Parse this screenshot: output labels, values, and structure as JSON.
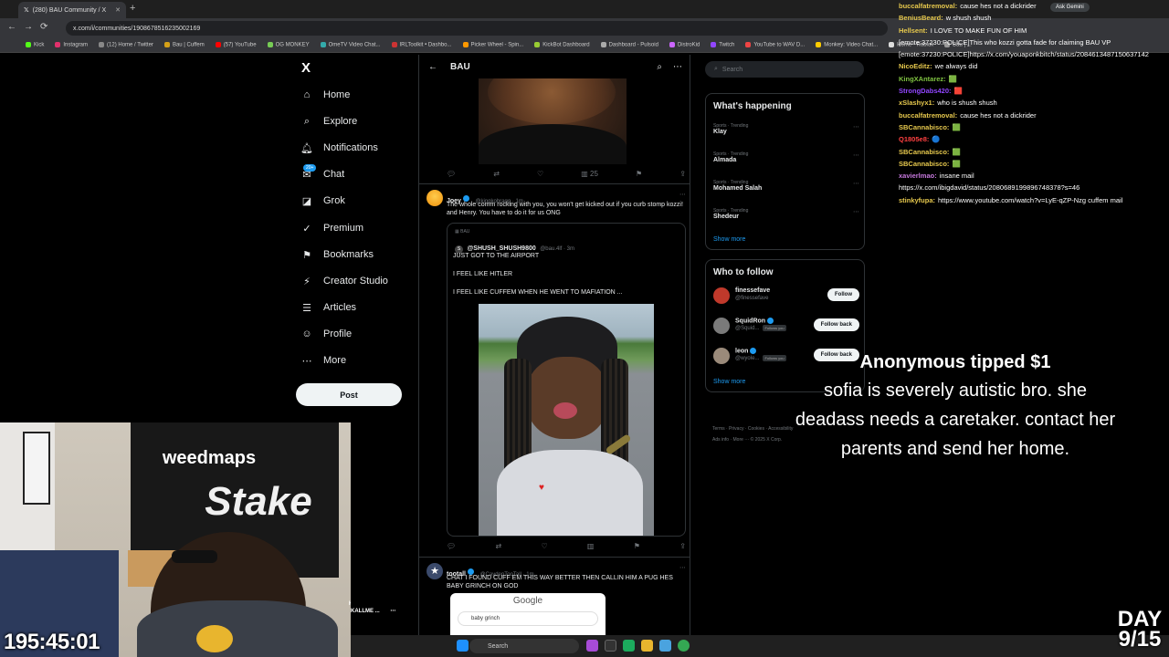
{
  "browser": {
    "tab_title": "(280) BAU Community / X",
    "url": "x.com/i/communities/1908678516235002169",
    "bookmarks": [
      "Kick",
      "Instagram",
      "(12) Home / Twitter",
      "Bau | Cuffem",
      "(57) YouTube",
      "OG MONKEY",
      "OmeTV Video Chat...",
      "IRLToolkit • Dashbo...",
      "Picker Wheel - Spin...",
      "KickBot Dashboard",
      "Dashboard - Pulsoid",
      "DistroKid",
      "Twitch",
      "YouTube to WAV D...",
      "Monkey: Video Chat...",
      "Home - Roblox",
      "Bau | ..."
    ],
    "bookmark_colors": [
      "#53fc18",
      "#e1306c",
      "#888888",
      "#d4a017",
      "#ff0000",
      "#7c5",
      "#3aa",
      "#c33",
      "#f90",
      "#9c3",
      "#aaa",
      "#c6f",
      "#9146ff",
      "#e44",
      "#fc0",
      "#ddd",
      "#999"
    ]
  },
  "nav": {
    "logo": "X",
    "items": [
      {
        "label": "Home",
        "icon": "home-icon",
        "glyph": "⌂"
      },
      {
        "label": "Explore",
        "icon": "search-icon",
        "glyph": "⌕"
      },
      {
        "label": "Notifications",
        "icon": "bell-icon",
        "glyph": "🔔︎"
      },
      {
        "label": "Chat",
        "icon": "chat-icon",
        "glyph": "✉"
      },
      {
        "label": "Grok",
        "icon": "grok-icon",
        "glyph": "◪"
      },
      {
        "label": "Premium",
        "icon": "premium-icon",
        "glyph": "✓"
      },
      {
        "label": "Bookmarks",
        "icon": "bookmark-icon",
        "glyph": "⚑"
      },
      {
        "label": "Creator Studio",
        "icon": "creator-icon",
        "glyph": "⚡"
      },
      {
        "label": "Articles",
        "icon": "articles-icon",
        "glyph": "☰"
      },
      {
        "label": "Profile",
        "icon": "profile-icon",
        "glyph": "☺"
      },
      {
        "label": "More",
        "icon": "more-icon",
        "glyph": "⋯"
      }
    ],
    "chat_badge": "20+",
    "post_label": "Post",
    "account_partial": "KALLME ..."
  },
  "center": {
    "title": "BAU",
    "tweet1_views": "25",
    "tweet2": {
      "name": "Joey",
      "handle": "@kingkobragg · 1m",
      "text": "The whole comm rocking with you, you won't get kicked out if you curb stomp kozzi! and Henry. You have to do it for us ONG",
      "quote_community": "BAU",
      "quote_name": "@SHUSH_SHUSH9800",
      "quote_handle": "@bau.4lf · 3m",
      "quote_lines": [
        "JUST GOT TO THE AIRPORT",
        "I FEEL LIKE HITLER",
        "I FEEL LIKE CUFFEM WHEN HE WENT TO MAFIATION ..."
      ]
    },
    "tweet3": {
      "name": "tootall",
      "handle": "@CaydenTooTall · 1m",
      "text": "CHAT I FOUND CUFF EM THIS WAY BETTER THEN CALLIN HIM A PUG HES BABY GRINCH ON GOD",
      "google_logo": "Google",
      "google_query": "baby grinch"
    }
  },
  "right": {
    "search_placeholder": "Search",
    "happening_title": "What's happening",
    "trends": [
      {
        "category": "Sports · Trending",
        "name": "Klay"
      },
      {
        "category": "Sports · Trending",
        "name": "Almada"
      },
      {
        "category": "Sports · Trending",
        "name": "Mohamed Salah"
      },
      {
        "category": "Sports · Trending",
        "name": "Shedeur"
      }
    ],
    "show_more": "Show more",
    "who_title": "Who to follow",
    "follows": [
      {
        "name": "finessefave",
        "handle": "@finessefave",
        "button": "Follow",
        "follows_you": ""
      },
      {
        "name": "SquidRon",
        "handle": "@Squid...",
        "button": "Follow back",
        "follows_you": "Follows you"
      },
      {
        "name": "leon",
        "handle": "@wyole...",
        "button": "Follow back",
        "follows_you": "Follows you"
      }
    ],
    "footer1": "Terms · Privacy · Cookies · Accessibility",
    "footer2": "Ads info · More ··· © 2025 X Corp."
  },
  "chat": {
    "ask_gemini": "Ask Gemini",
    "lines": [
      {
        "user": "buccalfatremoval:",
        "color": "#e6c84d",
        "msg": "cause hes not a dickrider"
      },
      {
        "user": "BeniusBeard:",
        "color": "#e6c84d",
        "msg": "w shush shush"
      },
      {
        "user": "Hellsent:",
        "color": "#e6c84d",
        "msg": "I LOVE TO MAKE FUN OF HIM"
      },
      {
        "user": "",
        "color": "#ffffff",
        "msg": "[emote:37230:POLICE]This who kozzi gotta fade for claiming BAU VP"
      },
      {
        "user": "",
        "color": "#ffffff",
        "msg": "[emote:37230:POLICE]https://x.com/youaponkbitch/status/2084613487150637142"
      },
      {
        "user": "NicoEditz:",
        "color": "#e6c84d",
        "msg": "we always did"
      },
      {
        "user": "KingXAntarez:",
        "color": "#7fc241",
        "msg": "🟩"
      },
      {
        "user": "StrongDabs420:",
        "color": "#9146ff",
        "msg": "🟥"
      },
      {
        "user": "xSlashyx1:",
        "color": "#e6c84d",
        "msg": "who is shush shush"
      },
      {
        "user": "buccalfatremoval:",
        "color": "#e6c84d",
        "msg": "cause hes not a dickrider"
      },
      {
        "user": "SBCannabisco:",
        "color": "#e6c84d",
        "msg": "🟩"
      },
      {
        "user": "Q1805e8:",
        "color": "#ff4040",
        "msg": "🔵"
      },
      {
        "user": "SBCannabisco:",
        "color": "#e6c84d",
        "msg": "🟩"
      },
      {
        "user": "SBCannabisco:",
        "color": "#e6c84d",
        "msg": "🟩"
      },
      {
        "user": "xavierlmao:",
        "color": "#c678dd",
        "msg": "insane mail"
      },
      {
        "user": "",
        "color": "#ffffff",
        "msg": "https://x.com/ibigdavid/status/2080689199896748378?s=46"
      },
      {
        "user": "stinkyfupa:",
        "color": "#e6c84d",
        "msg": "https://www.youtube.com/watch?v=LyE-qZP-Nzg cuffem mail"
      }
    ]
  },
  "tip": {
    "title": "Anonymous tipped $1",
    "message": "sofia is severely autistic bro. she deadass needs a caretaker. contact her parents and send her home."
  },
  "stream": {
    "timer": "195:45:01",
    "day_label": "DAY",
    "day_count": "9/15"
  },
  "webcam": {
    "banner_text1": "weedmaps",
    "banner_text2": "Stake"
  },
  "taskbar": {
    "search_label": "Search"
  }
}
